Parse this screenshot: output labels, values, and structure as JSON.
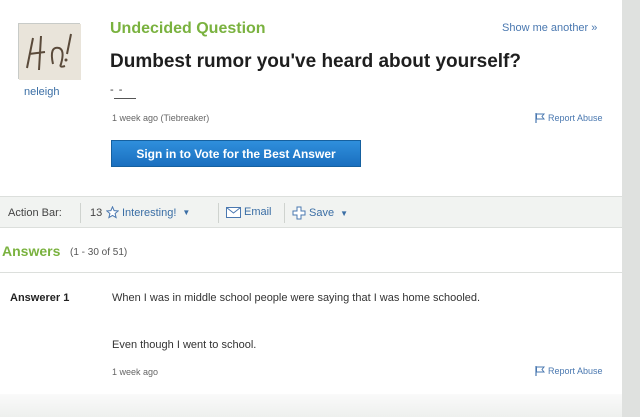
{
  "question": {
    "status_label": "Undecided Question",
    "show_another": "Show me another »",
    "title": "Dumbest rumor you've heard about yourself?",
    "details": "- -",
    "meta": "1 week ago (Tiebreaker)",
    "report_label": "Report Abuse",
    "vote_button": "Sign in to Vote for the Best Answer"
  },
  "asker": {
    "name": "neleigh",
    "avatar_text": "Ha"
  },
  "action_bar": {
    "label": "Action Bar:",
    "interesting_count": "13",
    "interesting_label": "Interesting!",
    "email_label": "Email",
    "save_label": "Save"
  },
  "answers": {
    "title": "Answers",
    "range": "(1 - 30 of 51)",
    "items": [
      {
        "answerer": "Answerer 1",
        "line1": "When I was in middle school people were saying that I was home schooled.",
        "line2": "Even though I went to school.",
        "meta": "1 week ago",
        "report_label": "Report Abuse"
      }
    ]
  },
  "colors": {
    "accent_green": "#7ab23f",
    "link_blue": "#3a6ea5",
    "button_blue": "#1a6fbf"
  },
  "icons": [
    "star-icon",
    "email-icon",
    "save-icon",
    "flag-icon",
    "chevron-down-icon"
  ]
}
